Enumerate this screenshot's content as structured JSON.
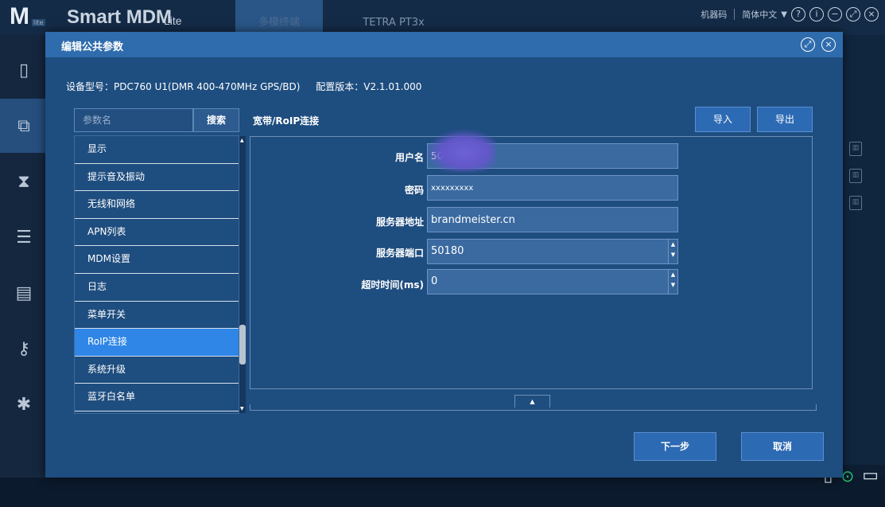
{
  "app": {
    "logo": "M",
    "logo_badge": "lite",
    "title": "Smart MDM",
    "title_suffix": "Lite",
    "tabs": [
      {
        "label": "多模终端",
        "active": true
      },
      {
        "label": "TETRA PT3x",
        "active": false
      }
    ],
    "top_right": {
      "machine_code": "机器码",
      "language": "简体中文",
      "controls": [
        "help-icon",
        "info-icon",
        "minimize-icon",
        "restore-icon",
        "close-icon"
      ]
    },
    "sidebar_icons": [
      "phone-icon",
      "device-copy-icon",
      "hourglass-icon",
      "list-settings-icon",
      "id-card-icon",
      "key-icon",
      "plugin-icon"
    ]
  },
  "dialog": {
    "title": "编辑公共参数",
    "device_model_label": "设备型号：",
    "device_model": "PDC760 U1(DMR 400-470MHz GPS/BD)",
    "config_version_label": "配置版本：",
    "config_version": "V2.1.01.000",
    "search": {
      "placeholder": "参数名",
      "button": "搜索"
    },
    "param_list": [
      {
        "label": "显示",
        "active": false
      },
      {
        "label": "提示音及振动",
        "active": false
      },
      {
        "label": "无线和网络",
        "active": false
      },
      {
        "label": "APN列表",
        "active": false
      },
      {
        "label": "MDM设置",
        "active": false
      },
      {
        "label": "日志",
        "active": false
      },
      {
        "label": "菜单开关",
        "active": false
      },
      {
        "label": "RoIP连接",
        "active": true
      },
      {
        "label": "系统升级",
        "active": false
      },
      {
        "label": "蓝牙白名单",
        "active": false
      }
    ],
    "breadcrumb": "宽带/RoIP连接",
    "import_button": "导入",
    "export_button": "导出",
    "form": {
      "username": {
        "label": "用户名",
        "value": "504"
      },
      "password": {
        "label": "密码",
        "value": "xxxxxxxxx"
      },
      "server_address": {
        "label": "服务器地址",
        "value": "brandmeister.cn"
      },
      "server_port": {
        "label": "服务器端口",
        "value": "50180"
      },
      "timeout": {
        "label": "超时时间(ms)",
        "value": "0"
      }
    },
    "next_button": "下一步",
    "cancel_button": "取消"
  }
}
